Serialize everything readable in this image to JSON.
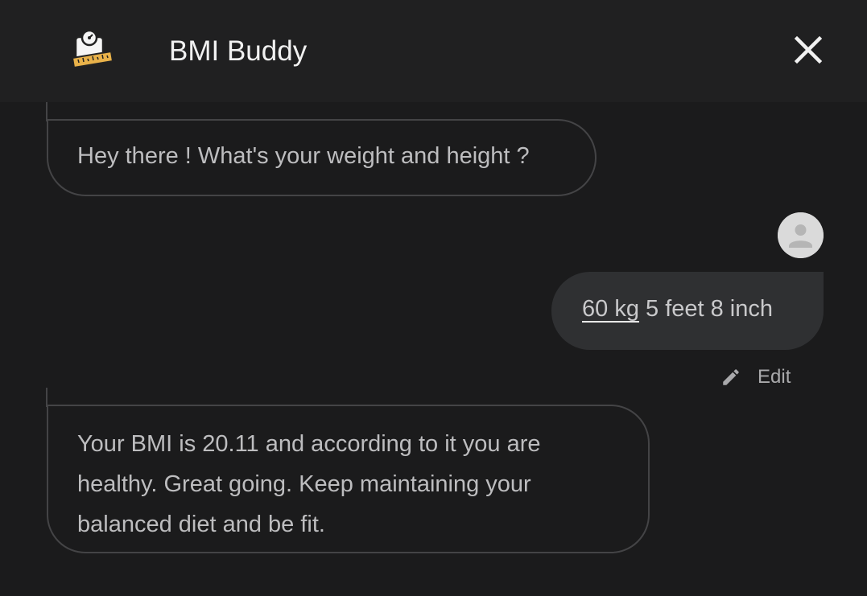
{
  "header": {
    "title": "BMI Buddy",
    "app_icon": "weighing-scale-tape-icon",
    "close_icon": "close-icon"
  },
  "messages": [
    {
      "sender": "bot",
      "text": "Hey there ! What's your weight and height ?"
    },
    {
      "sender": "user",
      "avatar_icon": "person-avatar-icon",
      "text_underlined": "60 kg",
      "text_rest": " 5 feet 8 inch"
    },
    {
      "sender": "bot",
      "text": "Your BMI is 20.11 and according to it you are healthy. Great going. Keep maintaining your balanced diet and be fit."
    }
  ],
  "edit": {
    "label": "Edit",
    "icon": "pencil-icon"
  },
  "colors": {
    "background": "#1b1b1c",
    "topbar": "#202021",
    "user_bubble": "#2f3032",
    "bot_bubble_border": "#444446"
  }
}
